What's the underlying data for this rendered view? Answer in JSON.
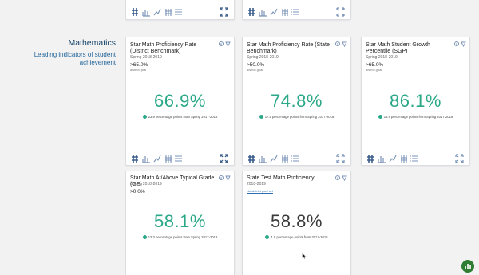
{
  "section": {
    "title": "Mathematics",
    "subtitle": "Leading indicators of student achievement"
  },
  "colors": {
    "accent_green": "#2aa888",
    "value_green": "#2aa888",
    "value_dark": "#3a3a3a",
    "section_title": "#18456b",
    "section_subtitle": "#23669a",
    "icon_blue": "#3a5d8c",
    "badge_green": "#2f7d32"
  },
  "toolbar_icons": [
    "hash-icon",
    "bar-chart-icon",
    "line-chart-icon",
    "stacked-bar-icon",
    "list-icon",
    "expand-icon"
  ],
  "cards": [
    {
      "title": "Star Math Proficiency Rate (District Benchmark)",
      "period": "Spring 2018-2019",
      "goal": ">65.0%",
      "goal_note": "district goal",
      "value": "66.9%",
      "change": "23.9 percentage points from Spring 2017-2018"
    },
    {
      "title": "Star Math Proficiency Rate (State Benchmark)",
      "period": "Spring 2018-2019",
      "goal": ">50.0%",
      "goal_note": "district goal",
      "value": "74.8%",
      "change": "17.5 percentage points from Spring 2017-2018"
    },
    {
      "title": "Star Math Student Growth Percentile (SGP)",
      "period": "Spring 2018-2019",
      "goal": ">65.0%",
      "goal_note": "district goal",
      "value": "86.1%",
      "change": "16.9 percentage points from Spring 2017-2018"
    },
    {
      "title": "Star Math At/Above Typical Grade (GE)",
      "period": "Spring 2018-2019",
      "goal": ">0.0%",
      "value": "58.1%",
      "change": "12.3 percentage points from Spring 2017-2018"
    },
    {
      "title": "State Test Math Proficiency",
      "period": "2018-2019",
      "link": "No district goal set",
      "value": "58.8%",
      "change": "1.8 percentage points from 2017-2018"
    }
  ]
}
